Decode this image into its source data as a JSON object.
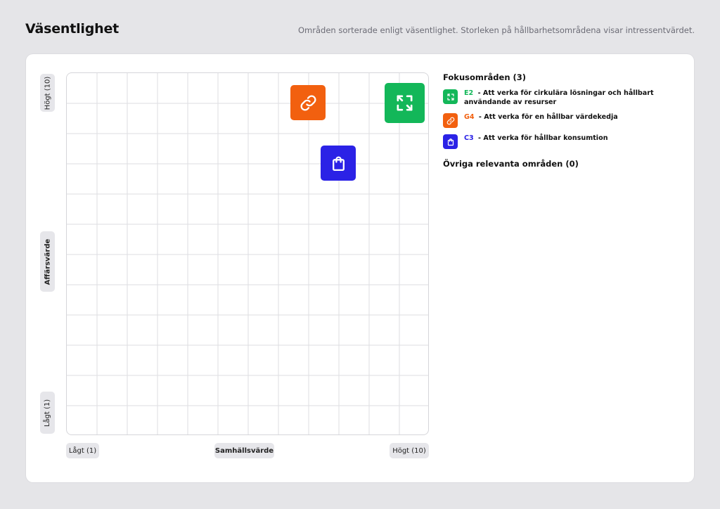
{
  "header": {
    "title": "Väsentlighet",
    "subtitle": "Områden sorterade enligt väsentlighet. Storleken på hållbarhetsområdena visar intressentvärdet."
  },
  "axes": {
    "y_label": "Affärsvärde",
    "y_high": "Högt (10)",
    "y_low": "Lågt (1)",
    "x_label": "Samhällsvärde",
    "x_low": "Lågt (1)",
    "x_high": "Högt (10)"
  },
  "legend": {
    "focus_title": "Fokusområden (3)",
    "other_title": "Övriga relevanta områden (0)",
    "items": [
      {
        "code": "E2",
        "sep": " - ",
        "text": "Att verka för cirkulära lösningar och hållbart användande av resurser",
        "color": "#13b759",
        "icon": "recycle-arrows-icon"
      },
      {
        "code": "G4",
        "sep": " - ",
        "text": "Att verka för en hållbar värdekedja",
        "color": "#f2600f",
        "icon": "link-icon"
      },
      {
        "code": "C3",
        "sep": " - ",
        "text": "Att verka för hållbar konsumtion",
        "color": "#2b22e6",
        "icon": "shopping-bag-icon"
      }
    ]
  },
  "chart_data": {
    "type": "scatter",
    "xlabel": "Samhällsvärde",
    "ylabel": "Affärsvärde",
    "xlim": [
      0,
      12
    ],
    "ylim": [
      0,
      12
    ],
    "grid": true,
    "points": [
      {
        "code": "E2",
        "x": 11.2,
        "y": 11.0,
        "size": "large",
        "color": "#13b759",
        "icon": "recycle-arrows-icon"
      },
      {
        "code": "G4",
        "x": 8.0,
        "y": 11.0,
        "size": "medium",
        "color": "#f2600f",
        "icon": "link-icon"
      },
      {
        "code": "C3",
        "x": 9.0,
        "y": 9.0,
        "size": "medium",
        "color": "#2b22e6",
        "icon": "shopping-bag-icon"
      }
    ]
  }
}
